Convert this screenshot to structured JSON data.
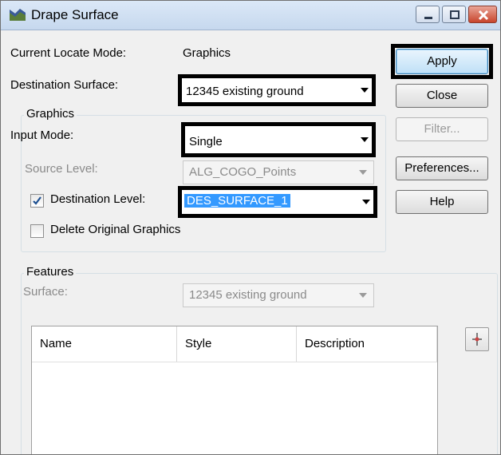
{
  "window": {
    "title": "Drape Surface",
    "icon": "drape-surface-app-icon"
  },
  "title_controls": [
    "minimize-icon",
    "maximize-icon",
    "close-icon"
  ],
  "current_locate_mode": {
    "label": "Current Locate Mode:",
    "value": "Graphics"
  },
  "destination_surface": {
    "label": "Destination Surface:",
    "value": "12345 existing ground"
  },
  "graphics_group": {
    "title": "Graphics",
    "input_mode": {
      "label": "Input Mode:",
      "value": "Single"
    },
    "source_level": {
      "label": "Source Level:",
      "value": "ALG_COGO_Points"
    },
    "destination_level": {
      "label": "Destination Level:",
      "value": "DES_SURFACE_1",
      "checked": true
    },
    "delete_original": {
      "label": "Delete Original Graphics",
      "checked": false
    }
  },
  "buttons": {
    "apply": "Apply",
    "close": "Close",
    "filter": "Filter...",
    "preferences": "Preferences...",
    "help": "Help"
  },
  "features_group": {
    "title": "Features",
    "surface": {
      "label": "Surface:",
      "value": "12345 existing ground"
    },
    "columns": [
      "Name",
      "Style",
      "Description"
    ]
  },
  "colors": {
    "highlight_border": "#000000",
    "selection": "#3399ff"
  }
}
